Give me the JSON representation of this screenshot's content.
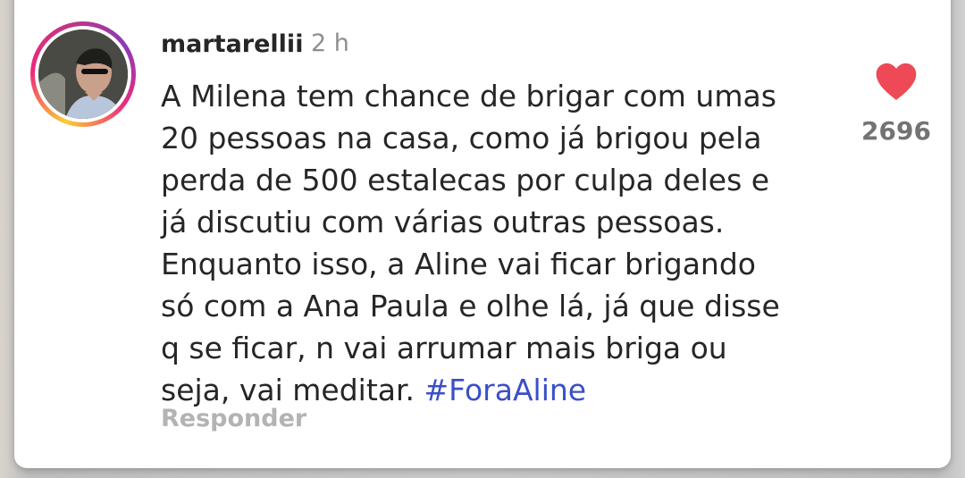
{
  "comment": {
    "username": "martarellii",
    "time": "2 h",
    "text_lines": [
      "A Milena tem chance de brigar com umas",
      "20 pessoas na casa, como já brigou pela",
      "perda de 500 estalecas por culpa deles e",
      "já discutiu com várias outras pessoas.",
      "Enquanto isso, a Aline vai ficar brigando",
      "só com a Ana Paula e olhe lá, já que disse",
      "q se ficar, n vai arrumar mais briga ou",
      "seja, vai meditar."
    ],
    "hashtag": "#ForaAline",
    "reply_label": "Responder",
    "likes": "2696"
  },
  "icons": {
    "like": "heart-icon",
    "avatar": "profile-photo"
  },
  "colors": {
    "heart": "#ed4956",
    "hashtag": "#3b4fc8",
    "text": "#262626",
    "muted": "#8e8e8e"
  }
}
